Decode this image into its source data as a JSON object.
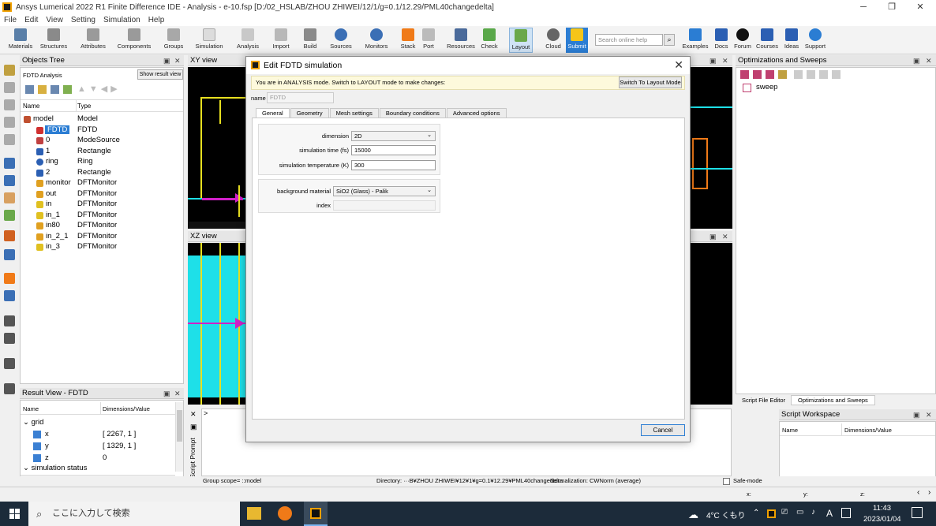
{
  "window": {
    "title": "Ansys Lumerical 2022 R1 Finite Difference IDE - Analysis - e-10.fsp [D:/02_HSLAB/ZHOU ZHIWEI/12/1/g=0.1/12.29/PML40changedelta]",
    "minimize": "─",
    "maximize": "❐",
    "close": "✕"
  },
  "menu": [
    "File",
    "Edit",
    "View",
    "Setting",
    "Simulation",
    "Help"
  ],
  "toolbar": {
    "buttons": [
      {
        "label": "Materials",
        "icon": "materials-icon"
      },
      {
        "label": "Structures",
        "icon": "structures-icon"
      },
      {
        "label": "Attributes",
        "icon": "attributes-icon"
      },
      {
        "label": "Components",
        "icon": "components-icon"
      },
      {
        "label": "Groups",
        "icon": "groups-icon"
      },
      {
        "label": "Simulation",
        "icon": "simulation-icon"
      },
      {
        "label": "Analysis",
        "icon": "analysis-icon"
      },
      {
        "label": "Import",
        "icon": "import-icon"
      },
      {
        "label": "Build",
        "icon": "build-icon"
      },
      {
        "label": "Sources",
        "icon": "sources-icon"
      },
      {
        "label": "Monitors",
        "icon": "monitors-icon"
      },
      {
        "label": "Stack",
        "icon": "stack-icon"
      },
      {
        "label": "Port",
        "icon": "port-icon"
      },
      {
        "label": "Resources",
        "icon": "resources-icon"
      },
      {
        "label": "Check",
        "icon": "check-icon"
      },
      {
        "label": "Layout",
        "icon": "layout-icon"
      },
      {
        "label": "Cloud",
        "icon": "cloud-icon"
      },
      {
        "label": "Submit",
        "icon": "submit-icon"
      },
      {
        "label": "Examples",
        "icon": "examples-icon"
      },
      {
        "label": "Docs",
        "icon": "docs-icon"
      },
      {
        "label": "Forum",
        "icon": "forum-icon"
      },
      {
        "label": "Courses",
        "icon": "courses-icon"
      },
      {
        "label": "Ideas",
        "icon": "ideas-icon"
      },
      {
        "label": "Support",
        "icon": "support-icon"
      }
    ],
    "search_placeholder": "Search online help"
  },
  "objects_tree": {
    "title": "Objects Tree",
    "analysis_label": "FDTD Analysis",
    "show_result_view": "Show result view",
    "col_name": "Name",
    "col_type": "Type",
    "items": [
      {
        "name": "model",
        "type": "Model"
      },
      {
        "name": "FDTD",
        "type": "FDTD"
      },
      {
        "name": "0",
        "type": "ModeSource"
      },
      {
        "name": "1",
        "type": "Rectangle"
      },
      {
        "name": "ring",
        "type": "Ring"
      },
      {
        "name": "2",
        "type": "Rectangle"
      },
      {
        "name": "monitor",
        "type": "DFTMonitor"
      },
      {
        "name": "out",
        "type": "DFTMonitor"
      },
      {
        "name": "in",
        "type": "DFTMonitor"
      },
      {
        "name": "in_1",
        "type": "DFTMonitor"
      },
      {
        "name": "in80",
        "type": "DFTMonitor"
      },
      {
        "name": "in_2_1",
        "type": "DFTMonitor"
      },
      {
        "name": "in_3",
        "type": "DFTMonitor"
      }
    ]
  },
  "result_view": {
    "title": "Result View - FDTD",
    "col_name": "Name",
    "col_value": "Dimensions/Value",
    "group": "grid",
    "rows": [
      {
        "name": "x",
        "value": "[ 2267, 1 ]"
      },
      {
        "name": "y",
        "value": "[ 1329, 1 ]"
      },
      {
        "name": "z",
        "value": "0"
      }
    ],
    "group2": "simulation status"
  },
  "views": {
    "xy": "XY view",
    "xz": "XZ view"
  },
  "script_prompt": {
    "label": "Script Prompt",
    "prompt": ">"
  },
  "optimizations": {
    "title": "Optimizations and Sweeps",
    "item": "sweep",
    "tab_script": "Script File Editor",
    "tab_opt": "Optimizations and Sweeps"
  },
  "script_workspace": {
    "title": "Script Workspace",
    "col_name": "Name",
    "col_value": "Dimensions/Value"
  },
  "dialog": {
    "title": "Edit FDTD simulation",
    "notice": "You are in ANALYSIS mode. Switch to LAYOUT mode to make changes:",
    "switch_button": "Switch To Layout Mode",
    "name_label": "name",
    "name_value": "FDTD",
    "tabs": [
      "General",
      "Geometry",
      "Mesh settings",
      "Boundary conditions",
      "Advanced options"
    ],
    "fields": {
      "dimension_label": "dimension",
      "dimension_value": "2D",
      "sim_time_label": "simulation time (fs)",
      "sim_time_value": "15000",
      "sim_temp_label": "simulation temperature (K)",
      "sim_temp_value": "300",
      "bg_material_label": "background material",
      "bg_material_value": "SiO2 (Glass) - Palik",
      "index_label": "index",
      "index_value": ""
    },
    "cancel": "Cancel"
  },
  "status": {
    "group_scope": "Group scope= ::model",
    "directory": "Directory: ···B¥ZHOU ZHIWEI¥12¥1¥g=0.1¥12.29¥PML40changedelta",
    "normalization": "Normalization: CWNorm (average)",
    "safe_mode": "Safe-mode",
    "x": "x:",
    "y": "y:",
    "z": "z:"
  },
  "taskbar": {
    "search": "ここに入力して検索",
    "weather": "4°C くもり",
    "time": "11:43",
    "date": "2023/01/04",
    "ime": "A"
  },
  "colors": {
    "accent": "#2b7dd3",
    "selection": "#2b7dd3",
    "cyan": "#1ee0e8",
    "yellow": "#e8e020",
    "magenta": "#d020c8",
    "orange": "#f07a18",
    "taskbar": "#1c2b3a"
  }
}
